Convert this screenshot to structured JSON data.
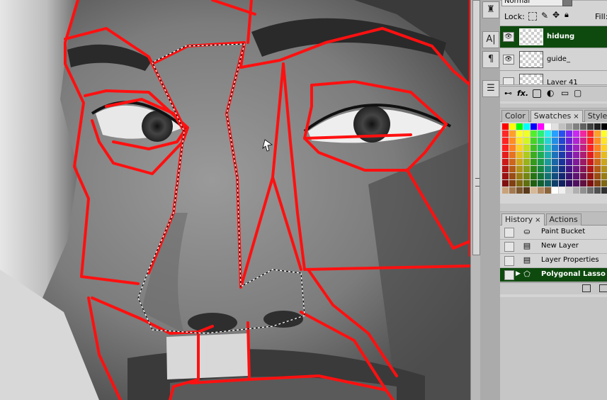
{
  "layers_panel": {
    "blend_mode": "Normal",
    "lock_label": "Lock:",
    "fill_label": "Fill:",
    "layers": [
      {
        "name": "hidung",
        "selected": true,
        "visible": true
      },
      {
        "name": "guide_",
        "selected": false,
        "visible": true
      },
      {
        "name": "Layer 41",
        "selected": false,
        "visible": false
      }
    ],
    "footer_icons": [
      "link-icon",
      "fx-icon",
      "mask-icon",
      "adjustment-icon",
      "folder-icon",
      "new-layer-icon"
    ]
  },
  "swatches_panel": {
    "tabs": [
      {
        "label": "Color",
        "active": false,
        "close": ""
      },
      {
        "label": "Swatches",
        "active": true,
        "close": "×"
      },
      {
        "label": "Styles",
        "active": false,
        "close": ""
      }
    ],
    "first_row": [
      "#ff0000",
      "#ffff00",
      "#00ff00",
      "#00ffff",
      "#0000ff",
      "#ff00ff"
    ],
    "hues": [
      "#ff2020",
      "#ff8020",
      "#ffd020",
      "#c0e020",
      "#40c020",
      "#20c060",
      "#20c0c0",
      "#2080d0",
      "#2040c0",
      "#6020c0",
      "#a020c0",
      "#c02080"
    ]
  },
  "history_panel": {
    "tabs": [
      {
        "label": "History",
        "active": true,
        "close": "×"
      },
      {
        "label": "Actions",
        "active": false,
        "close": ""
      }
    ],
    "items": [
      {
        "label": "Paint Bucket",
        "icon": "paint-bucket-icon",
        "glyph": "⛀",
        "selected": false
      },
      {
        "label": "New Layer",
        "icon": "new-layer-icon",
        "glyph": "▤",
        "selected": false
      },
      {
        "label": "Layer Properties",
        "icon": "layer-properties-icon",
        "glyph": "▤",
        "selected": false
      },
      {
        "label": "Polygonal Lasso",
        "icon": "polygonal-lasso-icon",
        "glyph": "⬠",
        "selected": true
      }
    ]
  },
  "dock_icons": [
    {
      "name": "brush-presets-icon",
      "glyph": "♜"
    },
    {
      "name": "character-icon",
      "glyph": "A|"
    },
    {
      "name": "paragraph-icon",
      "glyph": "¶"
    },
    {
      "name": "info-icon",
      "glyph": "☰"
    }
  ],
  "colors": {
    "selection": "#0e4a0e",
    "guide": "#ff1010"
  }
}
